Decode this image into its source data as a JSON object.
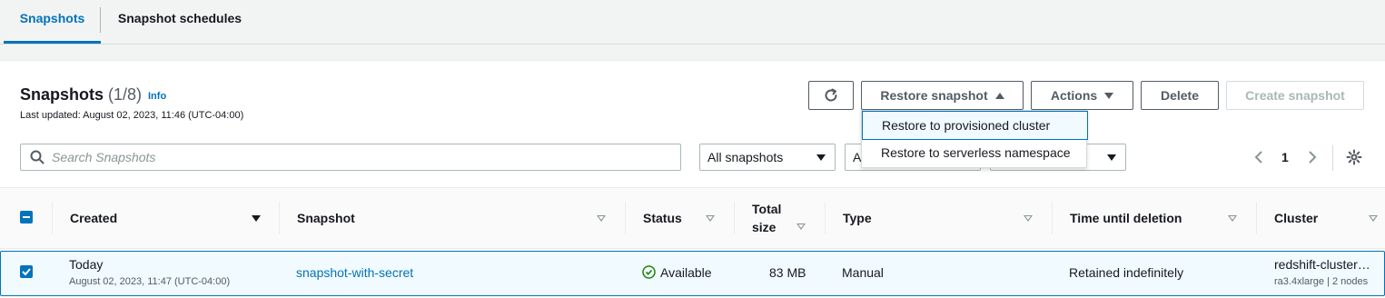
{
  "tabs": [
    {
      "label": "Snapshots",
      "active": true
    },
    {
      "label": "Snapshot schedules",
      "active": false
    }
  ],
  "header": {
    "title": "Snapshots",
    "count": "(1/8)",
    "info": "Info",
    "last_updated": "Last updated: August 02, 2023, 11:46 (UTC-04:00)"
  },
  "toolbar": {
    "refresh_icon": "refresh-icon",
    "restore_label": "Restore snapshot",
    "actions_label": "Actions",
    "delete_label": "Delete",
    "create_label": "Create snapshot"
  },
  "restore_menu": {
    "items": [
      {
        "label": "Restore to provisioned cluster"
      },
      {
        "label": "Restore to serverless namespace"
      }
    ]
  },
  "filters": {
    "search_placeholder": "Search Snapshots",
    "type_filter": "All snapshots",
    "second_filter_partial": "A",
    "page": "1"
  },
  "table": {
    "columns": [
      {
        "label": "Created"
      },
      {
        "label": "Snapshot"
      },
      {
        "label": "Status"
      },
      {
        "label": "Total size"
      },
      {
        "label": "Type"
      },
      {
        "label": "Time until deletion"
      },
      {
        "label": "Cluster"
      }
    ],
    "total_size_line1": "Total",
    "total_size_line2": "size",
    "rows": [
      {
        "created": "Today",
        "created_detail": "August 02, 2023, 11:47 (UTC-04:00)",
        "snapshot": "snapshot-with-secret",
        "status": "Available",
        "total_size": "83 MB",
        "type": "Manual",
        "time_until_deletion": "Retained indefinitely",
        "cluster": "redshift-cluster…",
        "cluster_detail": "ra3.4xlarge | 2 nodes"
      }
    ]
  },
  "colors": {
    "accent": "#0073bb",
    "status_ok": "#1d8102"
  }
}
